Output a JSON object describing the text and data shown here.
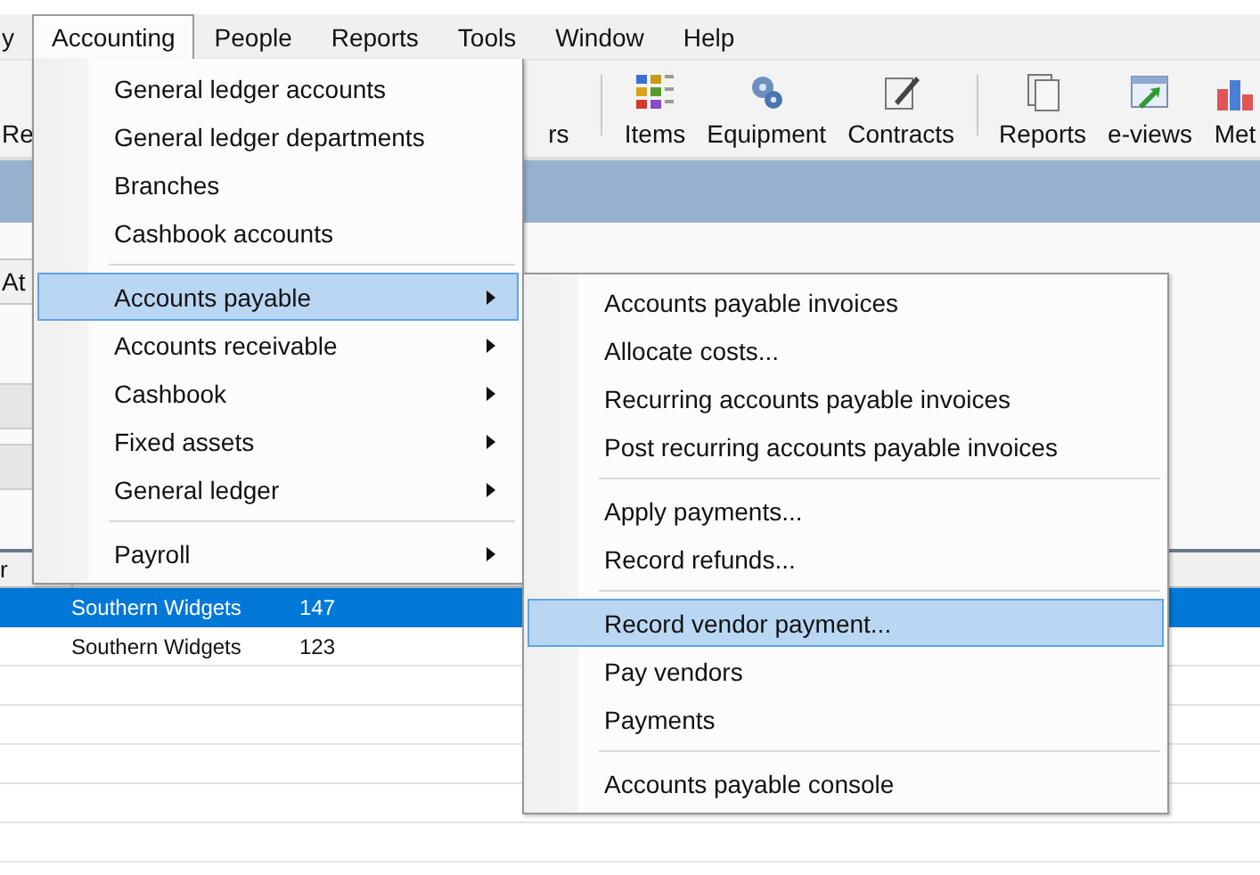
{
  "menubar": {
    "items": [
      {
        "label": "y",
        "selected": false
      },
      {
        "label": "Accounting",
        "selected": true
      },
      {
        "label": "People",
        "selected": false
      },
      {
        "label": "Reports",
        "selected": false
      },
      {
        "label": "Tools",
        "selected": false
      },
      {
        "label": "Window",
        "selected": false
      },
      {
        "label": "Help",
        "selected": false
      }
    ]
  },
  "toolbar": {
    "items": [
      {
        "kind": "button",
        "label": "Re"
      },
      {
        "kind": "button",
        "label": "rs"
      },
      {
        "kind": "separator"
      },
      {
        "kind": "button",
        "label": "Items"
      },
      {
        "kind": "button",
        "label": "Equipment"
      },
      {
        "kind": "button",
        "label": "Contracts"
      },
      {
        "kind": "separator"
      },
      {
        "kind": "button",
        "label": "Reports"
      },
      {
        "kind": "button",
        "label": "e-views"
      },
      {
        "kind": "button",
        "label": "Met"
      }
    ]
  },
  "tabs": [
    {
      "label": "At",
      "selected": false
    }
  ],
  "grid": {
    "columns": [
      "r"
    ],
    "rows": [
      {
        "cells": [
          "Southern Widgets",
          "147"
        ],
        "selected": true
      },
      {
        "cells": [
          "Southern Widgets",
          "123"
        ],
        "selected": false
      }
    ]
  },
  "menu": {
    "items": [
      {
        "kind": "item",
        "label": "General ledger accounts",
        "selected": false
      },
      {
        "kind": "item",
        "label": "General ledger departments",
        "selected": false
      },
      {
        "kind": "item",
        "label": "Branches",
        "selected": false
      },
      {
        "kind": "item",
        "label": "Cashbook accounts",
        "selected": false
      },
      {
        "kind": "separator"
      },
      {
        "kind": "submenu",
        "label": "Accounts payable",
        "selected": true
      },
      {
        "kind": "submenu",
        "label": "Accounts receivable",
        "selected": false
      },
      {
        "kind": "submenu",
        "label": "Cashbook",
        "selected": false
      },
      {
        "kind": "submenu",
        "label": "Fixed assets",
        "selected": false
      },
      {
        "kind": "submenu",
        "label": "General ledger",
        "selected": false
      },
      {
        "kind": "separator"
      },
      {
        "kind": "submenu",
        "label": "Payroll",
        "selected": false
      }
    ]
  },
  "submenu": {
    "items": [
      {
        "kind": "item",
        "label": "Accounts payable invoices",
        "selected": false
      },
      {
        "kind": "item",
        "label": "Allocate costs...",
        "selected": false
      },
      {
        "kind": "item",
        "label": "Recurring accounts payable invoices",
        "selected": false
      },
      {
        "kind": "item",
        "label": "Post recurring accounts payable invoices",
        "selected": false
      },
      {
        "kind": "separator"
      },
      {
        "kind": "item",
        "label": "Apply payments...",
        "selected": false
      },
      {
        "kind": "item",
        "label": "Record refunds...",
        "selected": false
      },
      {
        "kind": "separator"
      },
      {
        "kind": "item",
        "label": "Record vendor payment...",
        "selected": true
      },
      {
        "kind": "item",
        "label": "Pay vendors",
        "selected": false
      },
      {
        "kind": "item",
        "label": "Payments",
        "selected": false
      },
      {
        "kind": "separator"
      },
      {
        "kind": "item",
        "label": "Accounts payable console",
        "selected": false
      }
    ]
  }
}
